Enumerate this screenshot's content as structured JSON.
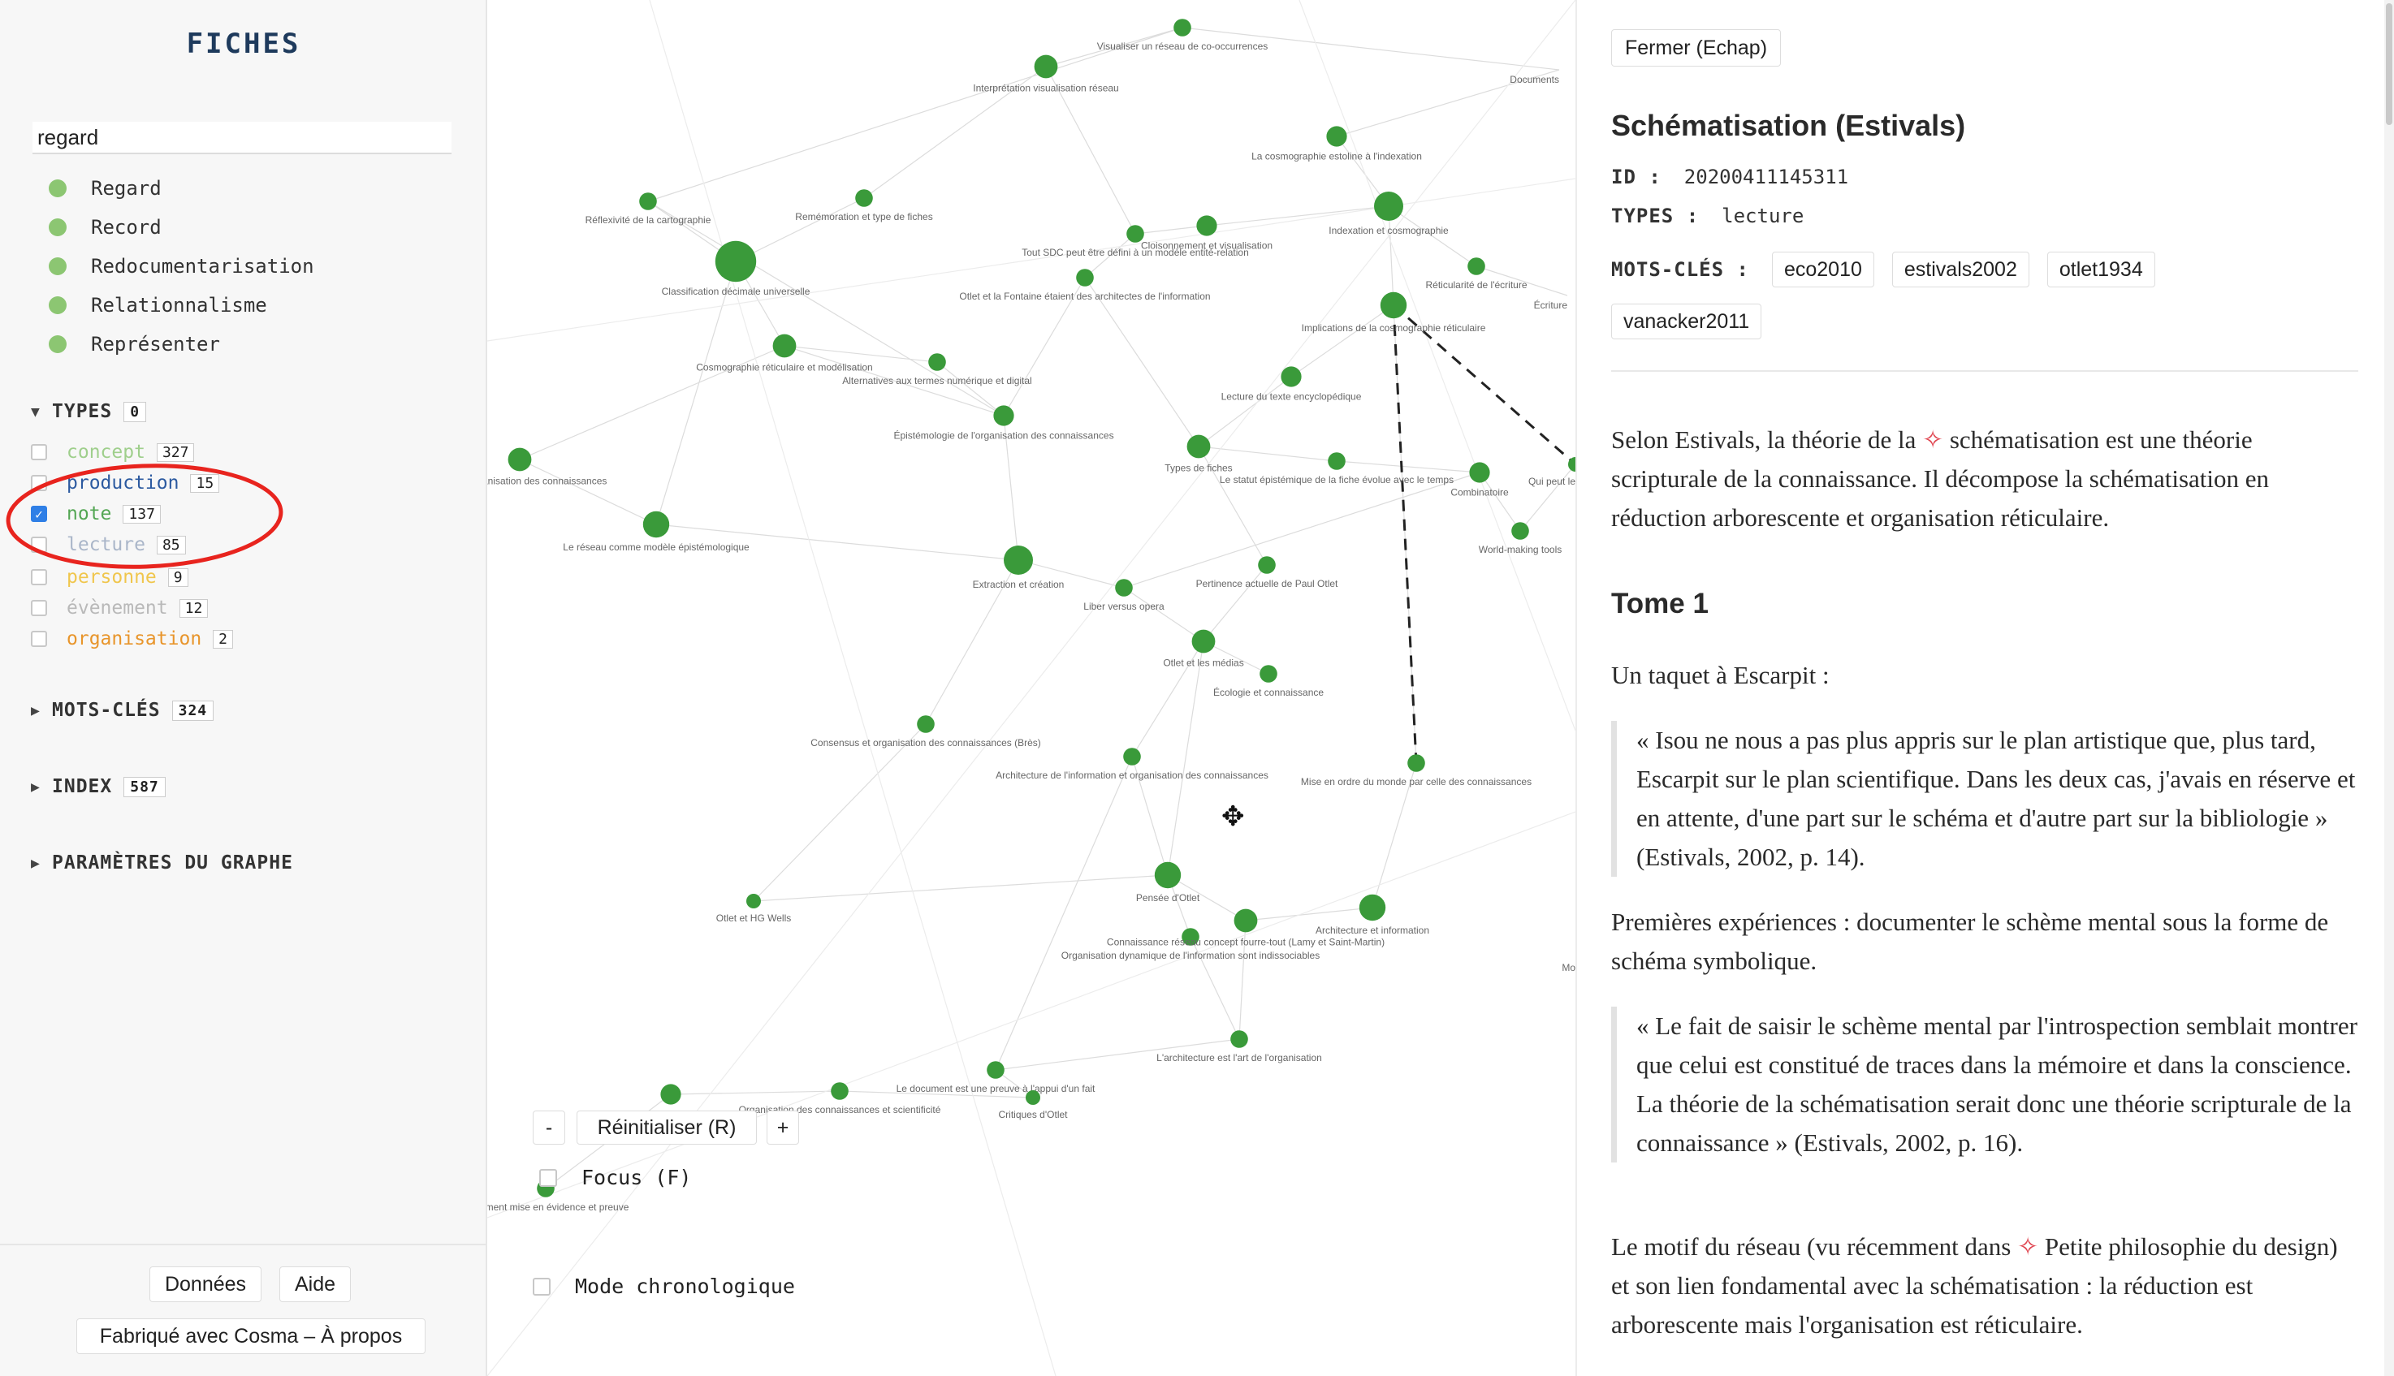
{
  "sidebar": {
    "title": "FICHES",
    "search_value": "regard",
    "results": [
      "Regard",
      "Record",
      "Redocumentarisation",
      "Relationnalisme",
      "Représenter"
    ],
    "types_section": {
      "label": "TYPES",
      "count": "0"
    },
    "types": [
      {
        "label": "concept",
        "count": "327",
        "checked": false,
        "color": "#9fcf8c"
      },
      {
        "label": "production",
        "count": "15",
        "checked": false,
        "color": "#2c5aa0"
      },
      {
        "label": "note",
        "count": "137",
        "checked": true,
        "color": "#53a653"
      },
      {
        "label": "lecture",
        "count": "85",
        "checked": false,
        "color": "#aab6c9"
      },
      {
        "label": "personne",
        "count": "9",
        "checked": false,
        "color": "#f0c64d"
      },
      {
        "label": "évènement",
        "count": "12",
        "checked": false,
        "color": "#b9b9b9"
      },
      {
        "label": "organisation",
        "count": "2",
        "checked": false,
        "color": "#e8952b"
      }
    ],
    "keywords_section": {
      "label": "MOTS-CLÉS",
      "count": "324"
    },
    "index_section": {
      "label": "INDEX",
      "count": "587"
    },
    "params_section": {
      "label": "PARAMÈTRES DU GRAPHE"
    },
    "buttons": {
      "data": "Données",
      "help": "Aide",
      "about": "Fabriqué avec Cosma – À propos"
    }
  },
  "graph": {
    "node_color": "#3a9a3a",
    "controls": {
      "zoom_out": "-",
      "reset": "Réinitialiser (R)",
      "zoom_in": "+",
      "focus": "Focus (F)",
      "chrono": "Mode chronologique"
    },
    "nodes": [
      {
        "label": "Visualiser un réseau de co-occurrences",
        "r": 6
      },
      {
        "label": "Interprétation visualisation réseau",
        "r": 8
      },
      {
        "label": "Documents",
        "r": 0
      },
      {
        "label": "La cosmographie estoline à l'indexation",
        "r": 7
      },
      {
        "label": "Réflexivité de la cartographie",
        "r": 6
      },
      {
        "label": "Remémoration et type de fiches",
        "r": 6
      },
      {
        "label": "Indexation et cosmographie",
        "r": 10
      },
      {
        "label": "Classification décimale universelle",
        "r": 14
      },
      {
        "label": "Tout SDC peut être défini à un modèle entité-relation",
        "r": 6
      },
      {
        "label": "Cloisonnement et visualisation",
        "r": 7
      },
      {
        "label": "Réticularité de l'écriture",
        "r": 6
      },
      {
        "label": "Otlet et la Fontaine étaient des architectes de l'information",
        "r": 6
      },
      {
        "label": "Implications de la cosmographie réticulaire",
        "r": 9
      },
      {
        "label": "Écriture",
        "r": 0
      },
      {
        "label": "Cosmographie réticulaire et modélisation",
        "r": 8
      },
      {
        "label": "Alternatives aux termes numérique et digital",
        "r": 6
      },
      {
        "label": "Lecture du texte encyclopédique",
        "r": 7
      },
      {
        "label": "Épistémologie de l'organisation des connaissances",
        "r": 7
      },
      {
        "label": "Formes organisation des connaissances",
        "r": 8
      },
      {
        "label": "Types de fiches",
        "r": 8
      },
      {
        "label": "Le statut épistémique de la fiche évolue avec le temps",
        "r": 6
      },
      {
        "label": "Combinatoire",
        "r": 7
      },
      {
        "label": "Qui peut le",
        "r": 5
      },
      {
        "label": "Le réseau comme modèle épistémologique",
        "r": 9
      },
      {
        "label": "World-making tools",
        "r": 6
      },
      {
        "label": "Extraction et création",
        "r": 10
      },
      {
        "label": "Pertinence actuelle de Paul Otlet",
        "r": 6
      },
      {
        "label": "Liber versus opera",
        "r": 6
      },
      {
        "label": "Otlet et les médias",
        "r": 8
      },
      {
        "label": "Écologie et connaissance",
        "r": 6
      },
      {
        "label": "Consensus et organisation des connaissances (Brès)",
        "r": 6
      },
      {
        "label": "Architecture de l'information et organisation des connaissances",
        "r": 6
      },
      {
        "label": "Mise en ordre du monde par celle des connaissances",
        "r": 6
      },
      {
        "label": "Pensée d'Otlet",
        "r": 9
      },
      {
        "label": "Otlet et HG Wells",
        "r": 5
      },
      {
        "label": "Organisation dynamique de l'information sont indissociables",
        "r": 6
      },
      {
        "label": "Connaissance réseau concept fourre-tout (Lamy et Saint-Martin)",
        "r": 8
      },
      {
        "label": "Architecture et information",
        "r": 9
      },
      {
        "label": "Mo",
        "r": 0
      },
      {
        "label": "L'architecture est l'art de l'organisation",
        "r": 6
      },
      {
        "label": "Le document est une preuve à l'appui d'un fait",
        "r": 6
      },
      {
        "label": "Critiques d'Otlet",
        "r": 5
      },
      {
        "label": "Organisation des connaissances et scientificité",
        "r": 6
      },
      {
        "label": "",
        "r": 7
      },
      {
        "label": "Document mise en évidence et preuve",
        "r": 6
      },
      {
        "label": "",
        "r": 0
      }
    ]
  },
  "record": {
    "close_label": "Fermer (Echap)",
    "title": "Schématisation (Estivals)",
    "id_label": "ID :",
    "id_value": "20200411145311",
    "types_label": "TYPES :",
    "types_value": "lecture",
    "keywords_label": "MOTS-CLÉS :",
    "keywords": [
      "eco2010",
      "estivals2002",
      "otlet1934",
      "vanacker2011"
    ],
    "intro_before": "Selon Estivals, la théorie de la ",
    "intro_link_icon": "✧",
    "intro_after": " schématisation est une théorie scripturale de la connaissance. Il décompose la schématisation en réduction arborescente et organisation réticulaire.",
    "heading": "Tome 1",
    "p1": "Un taquet à Escarpit :",
    "q1": "« Isou ne nous a pas plus appris sur le plan artistique que, plus tard, Escarpit sur le plan scientifique. Dans les deux cas, j'avais en réserve et en attente, d'une part sur le schéma et d'autre part sur la bibliologie » (Estivals, 2002, p. 14).",
    "p2": "Premières expériences : documenter le schème mental sous la forme de schéma symbolique.",
    "q2": "« Le fait de saisir le schème mental par l'introspection semblait montrer que celui est constitué de traces dans la mémoire et dans la conscience. La théorie de la schématisation serait donc une théorie scripturale de la connaissance » (Estivals, 2002, p. 16).",
    "p3_before": "Le motif du réseau (vu récemment dans ",
    "p3_link_icon": "✧",
    "p3_after": " Petite philosophie du design) et son lien fondamental avec la schématisation : la réduction est arborescente mais l'organisation est réticulaire."
  }
}
